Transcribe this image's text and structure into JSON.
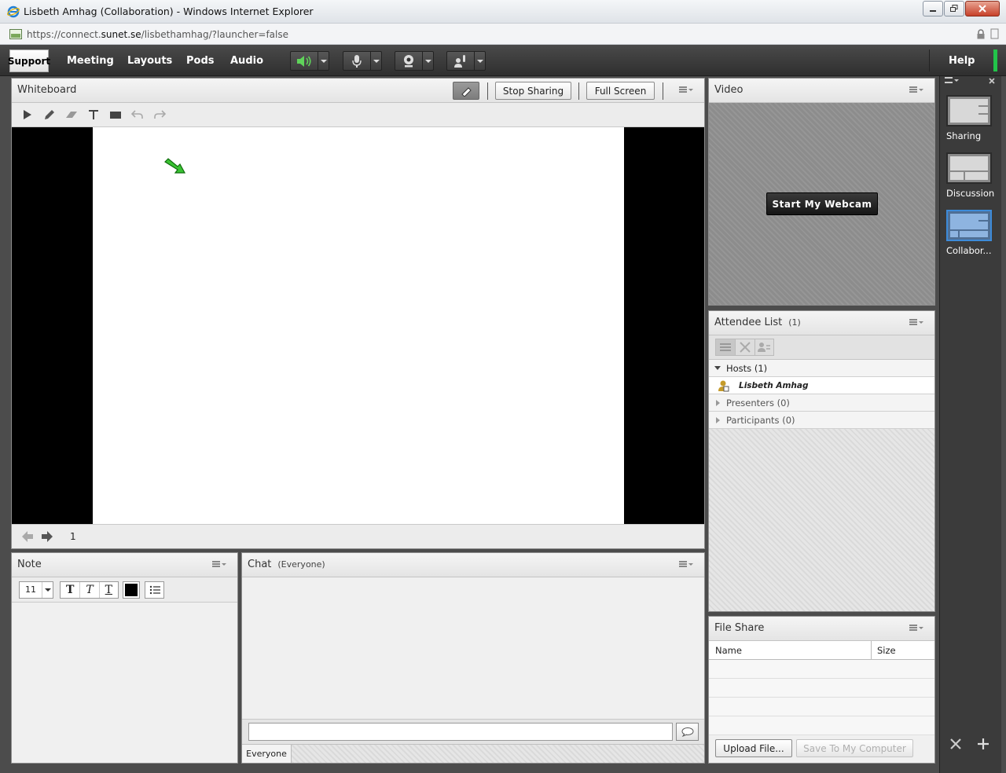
{
  "window": {
    "title": "Lisbeth Amhag (Collaboration) - Windows Internet Explorer",
    "url_prefix": "https://connect.",
    "url_domain": "sunet.se",
    "url_path": "/lisbethamhag/?launcher=false"
  },
  "menubar": {
    "support_label": "Support",
    "items": [
      "Meeting",
      "Layouts",
      "Pods",
      "Audio"
    ],
    "help_label": "Help"
  },
  "whiteboard": {
    "title": "Whiteboard",
    "stop_sharing_label": "Stop Sharing",
    "full_screen_label": "Full Screen",
    "page_number": "1"
  },
  "video": {
    "title": "Video",
    "start_webcam_label": "Start My Webcam"
  },
  "attendees": {
    "title": "Attendee List",
    "count": "(1)",
    "hosts_label": "Hosts (1)",
    "host_name": "Lisbeth Amhag",
    "presenters_label": "Presenters (0)",
    "participants_label": "Participants (0)"
  },
  "note": {
    "title": "Note",
    "font_size": "11"
  },
  "chat": {
    "title": "Chat",
    "scope": "(Everyone)",
    "tab_label": "Everyone"
  },
  "fileshare": {
    "title": "File Share",
    "col_name": "Name",
    "col_size": "Size",
    "upload_label": "Upload File...",
    "save_label": "Save To My Computer"
  },
  "layouts": {
    "items": [
      {
        "label": "Sharing"
      },
      {
        "label": "Discussion"
      },
      {
        "label": "Collabor..."
      }
    ],
    "active_index": 2
  },
  "colors": {
    "accent_green": "#22c34a",
    "active_layout_border": "#3d8bd9"
  }
}
